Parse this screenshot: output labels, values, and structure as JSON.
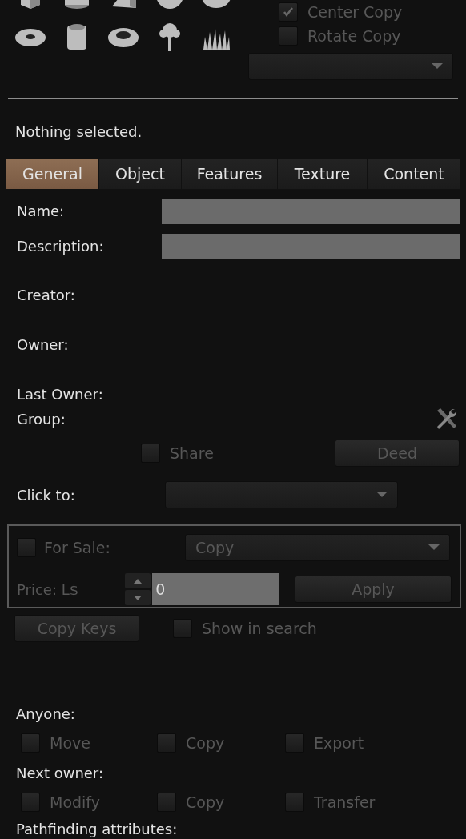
{
  "copy_options": [
    {
      "label": "Center Copy",
      "checked": true,
      "disabled": true
    },
    {
      "label": "Rotate Copy",
      "checked": false,
      "disabled": true
    }
  ],
  "selection_status": "Nothing selected.",
  "tabs": [
    {
      "label": "General",
      "selected": true
    },
    {
      "label": "Object",
      "selected": false
    },
    {
      "label": "Features",
      "selected": false
    },
    {
      "label": "Texture",
      "selected": false
    },
    {
      "label": "Content",
      "selected": false
    }
  ],
  "fields": [
    {
      "label": "Name:"
    },
    {
      "label": "Description:"
    }
  ],
  "info_rows": [
    "Creator:",
    "Owner:",
    "Last Owner:"
  ],
  "group_label": "Group:",
  "share": {
    "label": "Share",
    "checked": false,
    "disabled": true
  },
  "deed_button": {
    "label": "Deed",
    "disabled": true
  },
  "click_to_label": "Click to:",
  "sale": {
    "for_sale": {
      "label": "For Sale:",
      "checked": false,
      "disabled": true
    },
    "sale_type": "Copy",
    "price_label": "Price: L$",
    "price": "0",
    "apply_button": {
      "label": "Apply",
      "disabled": true
    }
  },
  "copy_keys_button": {
    "label": "Copy Keys",
    "disabled": true
  },
  "show_in_search": {
    "label": "Show in search",
    "checked": false,
    "disabled": true
  },
  "permissions": [
    {
      "title": "Anyone:",
      "options": [
        {
          "label": "Move",
          "checked": false,
          "disabled": true
        },
        {
          "label": "Copy",
          "checked": false,
          "disabled": true
        },
        {
          "label": "Export",
          "checked": false,
          "disabled": true
        }
      ]
    },
    {
      "title": "Next owner:",
      "options": [
        {
          "label": "Modify",
          "checked": false,
          "disabled": true
        },
        {
          "label": "Copy",
          "checked": false,
          "disabled": true
        },
        {
          "label": "Transfer",
          "checked": false,
          "disabled": true
        }
      ]
    }
  ],
  "pathfinding_label": "Pathfinding attributes:"
}
